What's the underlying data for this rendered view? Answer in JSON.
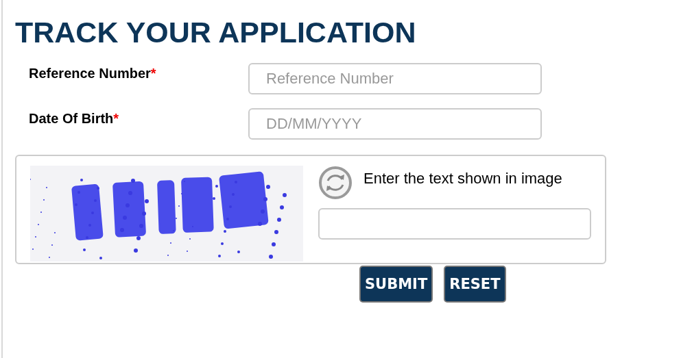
{
  "title": "TRACK YOUR APPLICATION",
  "fields": [
    {
      "label": "Reference Number",
      "required_mark": "*",
      "placeholder": "Reference Number"
    },
    {
      "label": "Date Of Birth",
      "required_mark": "*",
      "placeholder": "DD/MM/YYYY"
    }
  ],
  "captcha": {
    "prompt": "Enter the text shown in image"
  },
  "buttons": [
    "SUBMIT",
    "RESET"
  ]
}
